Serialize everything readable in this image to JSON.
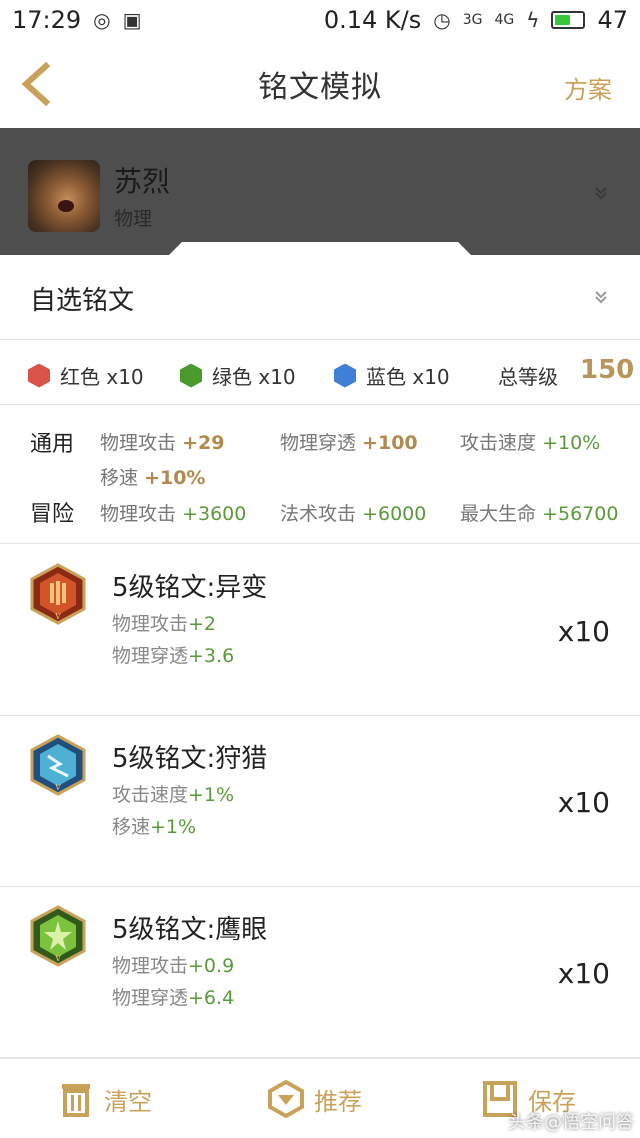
{
  "status_bar": {
    "time": "17:29",
    "net_speed": "0.14 K/s",
    "signal_3g": "3G",
    "signal_4g": "4G",
    "battery": "47",
    "battery_level": 0.47
  },
  "nav": {
    "title": "铭文模拟",
    "action": "方案"
  },
  "hero": {
    "name": "苏烈",
    "type": "物理"
  },
  "select": {
    "label": "自选铭文"
  },
  "summary": {
    "colors": [
      {
        "label": "红色 x10",
        "color": "#d9534a"
      },
      {
        "label": "绿色 x10",
        "color": "#4a9a2e"
      },
      {
        "label": "蓝色 x10",
        "color": "#3f7fd6"
      }
    ],
    "total_label": "总等级",
    "total_value": "150"
  },
  "stats": {
    "general_label": "通用",
    "general": [
      {
        "name": "物理攻击",
        "value": "+29"
      },
      {
        "name": "物理穿透",
        "value": "+100"
      },
      {
        "name": "攻击速度",
        "value": "+10%"
      },
      {
        "name": "移速",
        "value": "+10%"
      }
    ],
    "adventure_label": "冒险",
    "adventure": [
      {
        "name": "物理攻击",
        "value": "+3600"
      },
      {
        "name": "法术攻击",
        "value": "+6000"
      },
      {
        "name": "最大生命",
        "value": "+56700"
      }
    ]
  },
  "runes": [
    {
      "name": "5级铭文:异变",
      "icon": "red-rune-icon",
      "attrs": [
        {
          "name": "物理攻击",
          "value": "+2"
        },
        {
          "name": "物理穿透",
          "value": "+3.6"
        }
      ],
      "count": "x10"
    },
    {
      "name": "5级铭文:狩猎",
      "icon": "blue-rune-icon",
      "attrs": [
        {
          "name": "攻击速度",
          "value": "+1%"
        },
        {
          "name": "移速",
          "value": "+1%"
        }
      ],
      "count": "x10"
    },
    {
      "name": "5级铭文:鹰眼",
      "icon": "green-rune-icon",
      "attrs": [
        {
          "name": "物理攻击",
          "value": "+0.9"
        },
        {
          "name": "物理穿透",
          "value": "+6.4"
        }
      ],
      "count": "x10"
    }
  ],
  "bottom_bar": {
    "clear": "清空",
    "recommend": "推荐",
    "save": "保存"
  },
  "watermark": "头条@悟空问答",
  "colors": {
    "accent": "#c9a25a",
    "hero_panel": "#4e4e4e",
    "stat_gold": "#b08a4e",
    "stat_green": "#5a9a3a"
  }
}
